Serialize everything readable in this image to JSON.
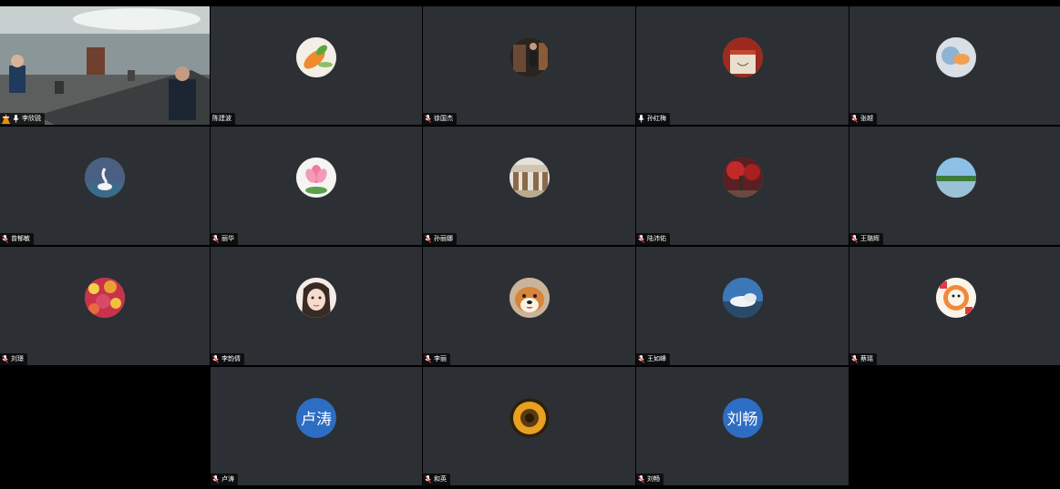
{
  "participants": [
    {
      "name": "李欣锐",
      "avatar": "video-feed",
      "mic": "on",
      "active": true
    },
    {
      "name": "陈建波",
      "avatar": "carrot-photo",
      "mic": "muted"
    },
    {
      "name": "徐国杰",
      "avatar": "room-photo",
      "mic": "muted"
    },
    {
      "name": "孙红梅",
      "avatar": "dog-bowl-photo",
      "mic": "on"
    },
    {
      "name": "张越",
      "avatar": "painting-photo",
      "mic": "muted"
    },
    {
      "name": "曾郁敏",
      "avatar": "swan-photo",
      "mic": "muted"
    },
    {
      "name": "丽华",
      "avatar": "lotus-photo",
      "mic": "muted"
    },
    {
      "name": "孙丽娜",
      "avatar": "street-photo",
      "mic": "muted"
    },
    {
      "name": "陆沛佑",
      "avatar": "red-tree-photo",
      "mic": "muted"
    },
    {
      "name": "王璐辉",
      "avatar": "lake-photo",
      "mic": "muted"
    },
    {
      "name": "刘璟",
      "avatar": "flowers-photo",
      "mic": "muted"
    },
    {
      "name": "李韵倩",
      "avatar": "anime-girl-photo",
      "mic": "muted"
    },
    {
      "name": "李丽",
      "avatar": "shiba-photo",
      "mic": "muted"
    },
    {
      "name": "王如峰",
      "avatar": "clouds-photo",
      "mic": "muted"
    },
    {
      "name": "蔡瑶",
      "avatar": "cartoon-photo",
      "mic": "muted"
    },
    {
      "name": "卢涛",
      "avatar_text": "卢涛",
      "mic": "muted"
    },
    {
      "name": "和英",
      "avatar": "sunflower-photo",
      "mic": "muted"
    },
    {
      "name": "刘畅",
      "avatar_text": "刘畅",
      "mic": "muted"
    }
  ],
  "colors": {
    "tile_bg": "#2c2f33",
    "active_border": "#2ecc71",
    "text_avatar_bg": "#2d6dc3",
    "mute_red": "#e0393e",
    "vlc_orange": "#f08a00"
  }
}
